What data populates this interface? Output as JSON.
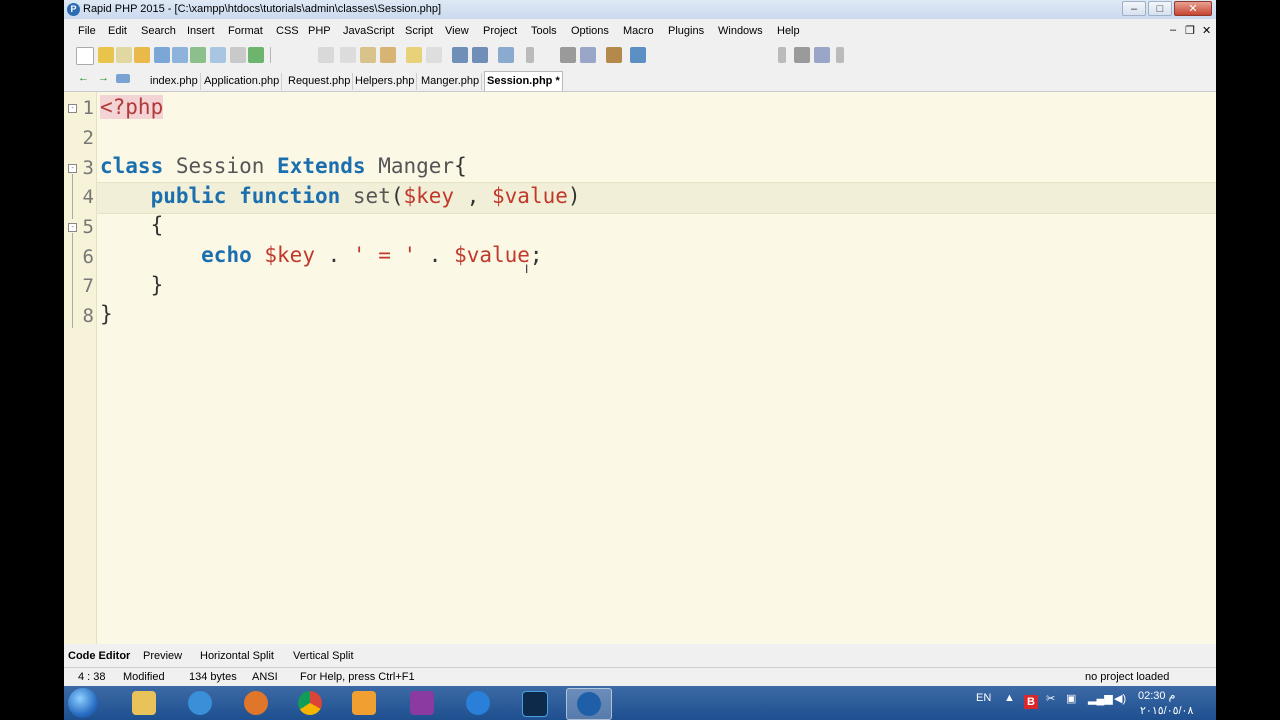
{
  "window": {
    "title": "Rapid PHP 2015 - [C:\\xampp\\htdocs\\tutorials\\admin\\classes\\Session.php]",
    "app_icon_letter": "P",
    "controls": {
      "minimize": "–",
      "maximize": "□",
      "close": "✕"
    }
  },
  "menu": {
    "items": [
      "File",
      "Edit",
      "Search",
      "Insert",
      "Format",
      "CSS",
      "PHP",
      "JavaScript",
      "Script",
      "View",
      "Project",
      "Tools",
      "Options",
      "Macro",
      "Plugins",
      "Windows",
      "Help"
    ],
    "doc_controls": {
      "minimize": "–",
      "restore": "❐",
      "close": "✕"
    }
  },
  "nav": {
    "back": "←",
    "forward": "→"
  },
  "tabs": [
    {
      "label": "index.php"
    },
    {
      "label": "Application.php"
    },
    {
      "label": "Request.php"
    },
    {
      "label": "Helpers.php"
    },
    {
      "label": "Manger.php"
    },
    {
      "label": "Session.php *"
    }
  ],
  "editor": {
    "line_numbers": [
      "1",
      "2",
      "3",
      "4",
      "5",
      "6",
      "7",
      "8"
    ],
    "fold_markers": {
      "l1": "-",
      "l3": "-",
      "l5": "-"
    },
    "lines": {
      "l1": {
        "open": "<?php"
      },
      "l3": {
        "kw1": "class",
        "name": "Session",
        "kw2": "Extends",
        "parent": "Manger",
        "brace": "{"
      },
      "l4": {
        "kw1": "public",
        "kw2": "function",
        "fn": "set",
        "p1": "(",
        "arg1": "$key",
        "comma": " , ",
        "arg2": "$value",
        "p2": ")"
      },
      "l5": {
        "brace": "{"
      },
      "l6": {
        "kw": "echo",
        "v1": "$key",
        "dot1": " . ",
        "s": "' = '",
        "dot2": " . ",
        "v2": "$value",
        "semi": ";"
      },
      "l7": {
        "brace": "}"
      },
      "l8": {
        "brace": "}"
      }
    },
    "cursor_glyph": "I"
  },
  "bottom_tabs": [
    "Code Editor",
    "Preview",
    "Horizontal Split",
    "Vertical Split"
  ],
  "status": {
    "position": "4 : 38",
    "state": "Modified",
    "size": "134 bytes",
    "encoding": "ANSI",
    "help": "For Help, press Ctrl+F1",
    "project": "no project loaded"
  },
  "taskbar": {
    "tray_lang": "EN",
    "tray_b": "B",
    "time": "02:30 م",
    "date": "٢٠١٥/٠٥/٠٨"
  }
}
